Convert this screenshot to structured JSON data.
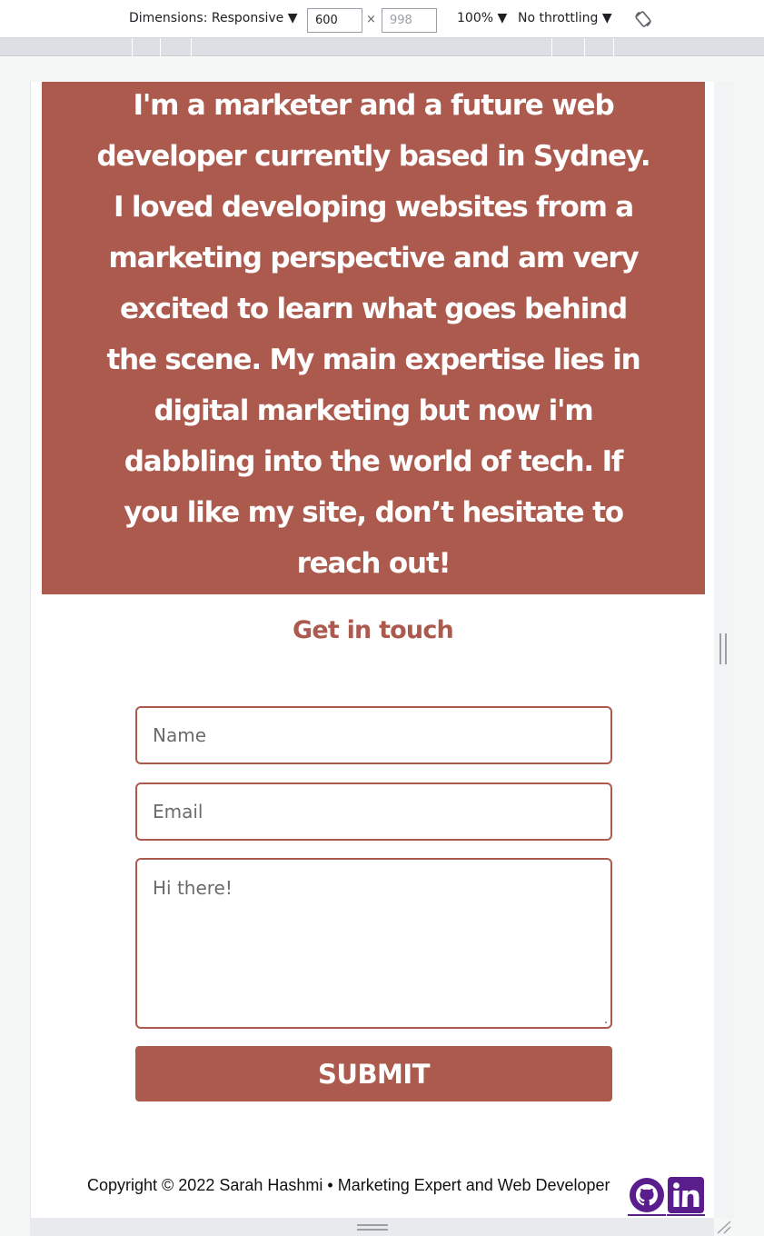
{
  "devtools": {
    "dimensions_label": "Dimensions: Responsive ▼",
    "width_value": "600",
    "height_placeholder": "998",
    "times": "×",
    "zoom": "100% ▼",
    "throttling": "No throttling ▼"
  },
  "about": {
    "text": "I'm a marketer and a future web developer currently based in Sydney. I loved developing websites from a marketing perspective and am very excited to learn what goes behind the scene. My main expertise lies in digital marketing but now i'm dabbling into the world of tech. If you like my site, don’t hesitate to reach out!"
  },
  "contact": {
    "title": "Get in touch",
    "name_placeholder": "Name",
    "email_placeholder": "Email",
    "message_placeholder": "Hi there!",
    "submit_label": "SUBMIT"
  },
  "footer": {
    "copyright": "Copyright © 2022 Sarah Hashmi • Marketing Expert and Web Developer",
    "icons": [
      "github-icon",
      "linkedin-icon"
    ]
  },
  "colors": {
    "accent": "#ad5a4e",
    "social": "#5a1e8c"
  }
}
